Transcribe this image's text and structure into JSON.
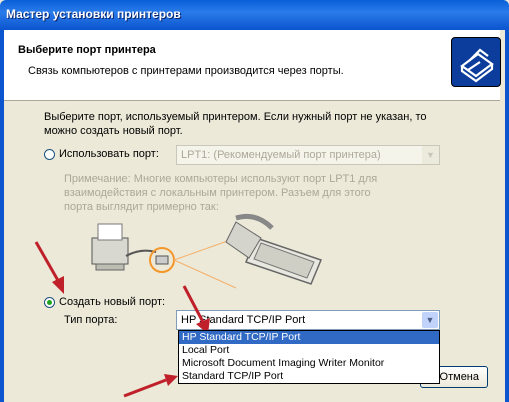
{
  "window": {
    "title": "Мастер установки принтеров"
  },
  "header": {
    "title": "Выберите порт принтера",
    "subtitle": "Связь компьютеров с принтерами производится через порты."
  },
  "intro_text": "Выберите порт, используемый принтером. Если нужный порт не указан, то можно создать новый порт.",
  "use_port": {
    "label": "Использовать порт:",
    "selected": false,
    "value": "LPT1: (Рекомендуемый порт принтера)"
  },
  "note": "Примечание: Многие компьютеры используют порт LPT1 для взаимодействия с локальным принтером. Разъем для этого порта выглядит примерно так:",
  "create_port": {
    "label": "Создать новый порт:",
    "selected": true,
    "type_label": "Тип порта:",
    "value": "HP Standard TCP/IP Port",
    "options": [
      "HP Standard TCP/IP Port",
      "Local Port",
      "Microsoft Document Imaging Writer Monitor",
      "Standard TCP/IP Port"
    ],
    "highlighted_index": 0
  },
  "buttons": {
    "cancel": "Отмена"
  },
  "colors": {
    "title_blue": "#0b55cf",
    "highlight": "#316ac5",
    "annotation_arrow": "#c0202a"
  }
}
